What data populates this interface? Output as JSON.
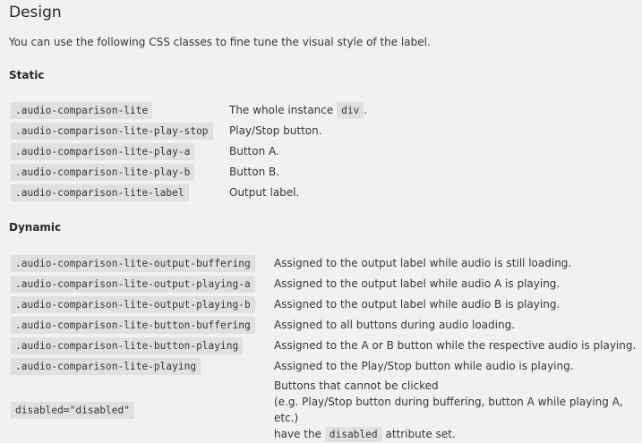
{
  "section": {
    "title": "Design",
    "intro": "You can use the following CSS classes to fine tune the visual style of the label."
  },
  "static": {
    "heading": "Static",
    "rows": [
      {
        "code": ".audio-comparison-lite",
        "desc_before": "The whole instance ",
        "desc_code": "div",
        "desc_after": "."
      },
      {
        "code": ".audio-comparison-lite-play-stop",
        "desc": "Play/Stop button."
      },
      {
        "code": ".audio-comparison-lite-play-a",
        "desc": "Button A."
      },
      {
        "code": ".audio-comparison-lite-play-b",
        "desc": "Button B."
      },
      {
        "code": ".audio-comparison-lite-label",
        "desc": "Output label."
      }
    ]
  },
  "dynamic": {
    "heading": "Dynamic",
    "rows": [
      {
        "code": ".audio-comparison-lite-output-buffering",
        "desc": "Assigned to the output label while audio is still loading."
      },
      {
        "code": ".audio-comparison-lite-output-playing-a",
        "desc": "Assigned to the output label while audio A is playing."
      },
      {
        "code": ".audio-comparison-lite-output-playing-b",
        "desc": "Assigned to the output label while audio B is playing."
      },
      {
        "code": ".audio-comparison-lite-button-buffering",
        "desc": "Assigned to all buttons during audio loading."
      },
      {
        "code": ".audio-comparison-lite-button-playing",
        "desc": "Assigned to the A or B button while the respective audio is playing."
      },
      {
        "code": ".audio-comparison-lite-playing",
        "desc": "Assigned to the Play/Stop button while audio is playing."
      },
      {
        "code": "disabled=\"disabled\"",
        "desc_line1": "Buttons that cannot be clicked",
        "desc_line2": "(e.g. Play/Stop button during buffering, button A while playing A, etc.)",
        "desc_line3_before": "have the ",
        "desc_line3_code": "disabled",
        "desc_line3_after": " attribute set."
      }
    ]
  }
}
